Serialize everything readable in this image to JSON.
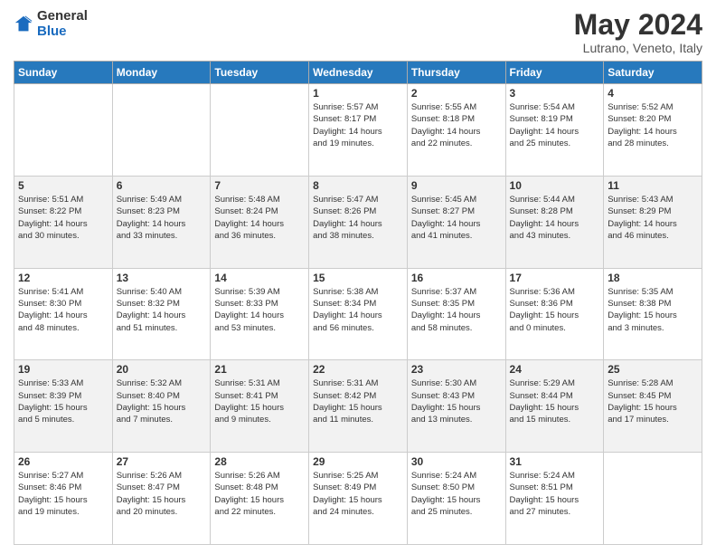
{
  "header": {
    "logo": {
      "general": "General",
      "blue": "Blue"
    },
    "title": "May 2024",
    "subtitle": "Lutrano, Veneto, Italy"
  },
  "calendar": {
    "weekdays": [
      "Sunday",
      "Monday",
      "Tuesday",
      "Wednesday",
      "Thursday",
      "Friday",
      "Saturday"
    ],
    "weeks": [
      [
        {
          "day": "",
          "info": ""
        },
        {
          "day": "",
          "info": ""
        },
        {
          "day": "",
          "info": ""
        },
        {
          "day": "1",
          "info": "Sunrise: 5:57 AM\nSunset: 8:17 PM\nDaylight: 14 hours\nand 19 minutes."
        },
        {
          "day": "2",
          "info": "Sunrise: 5:55 AM\nSunset: 8:18 PM\nDaylight: 14 hours\nand 22 minutes."
        },
        {
          "day": "3",
          "info": "Sunrise: 5:54 AM\nSunset: 8:19 PM\nDaylight: 14 hours\nand 25 minutes."
        },
        {
          "day": "4",
          "info": "Sunrise: 5:52 AM\nSunset: 8:20 PM\nDaylight: 14 hours\nand 28 minutes."
        }
      ],
      [
        {
          "day": "5",
          "info": "Sunrise: 5:51 AM\nSunset: 8:22 PM\nDaylight: 14 hours\nand 30 minutes."
        },
        {
          "day": "6",
          "info": "Sunrise: 5:49 AM\nSunset: 8:23 PM\nDaylight: 14 hours\nand 33 minutes."
        },
        {
          "day": "7",
          "info": "Sunrise: 5:48 AM\nSunset: 8:24 PM\nDaylight: 14 hours\nand 36 minutes."
        },
        {
          "day": "8",
          "info": "Sunrise: 5:47 AM\nSunset: 8:26 PM\nDaylight: 14 hours\nand 38 minutes."
        },
        {
          "day": "9",
          "info": "Sunrise: 5:45 AM\nSunset: 8:27 PM\nDaylight: 14 hours\nand 41 minutes."
        },
        {
          "day": "10",
          "info": "Sunrise: 5:44 AM\nSunset: 8:28 PM\nDaylight: 14 hours\nand 43 minutes."
        },
        {
          "day": "11",
          "info": "Sunrise: 5:43 AM\nSunset: 8:29 PM\nDaylight: 14 hours\nand 46 minutes."
        }
      ],
      [
        {
          "day": "12",
          "info": "Sunrise: 5:41 AM\nSunset: 8:30 PM\nDaylight: 14 hours\nand 48 minutes."
        },
        {
          "day": "13",
          "info": "Sunrise: 5:40 AM\nSunset: 8:32 PM\nDaylight: 14 hours\nand 51 minutes."
        },
        {
          "day": "14",
          "info": "Sunrise: 5:39 AM\nSunset: 8:33 PM\nDaylight: 14 hours\nand 53 minutes."
        },
        {
          "day": "15",
          "info": "Sunrise: 5:38 AM\nSunset: 8:34 PM\nDaylight: 14 hours\nand 56 minutes."
        },
        {
          "day": "16",
          "info": "Sunrise: 5:37 AM\nSunset: 8:35 PM\nDaylight: 14 hours\nand 58 minutes."
        },
        {
          "day": "17",
          "info": "Sunrise: 5:36 AM\nSunset: 8:36 PM\nDaylight: 15 hours\nand 0 minutes."
        },
        {
          "day": "18",
          "info": "Sunrise: 5:35 AM\nSunset: 8:38 PM\nDaylight: 15 hours\nand 3 minutes."
        }
      ],
      [
        {
          "day": "19",
          "info": "Sunrise: 5:33 AM\nSunset: 8:39 PM\nDaylight: 15 hours\nand 5 minutes."
        },
        {
          "day": "20",
          "info": "Sunrise: 5:32 AM\nSunset: 8:40 PM\nDaylight: 15 hours\nand 7 minutes."
        },
        {
          "day": "21",
          "info": "Sunrise: 5:31 AM\nSunset: 8:41 PM\nDaylight: 15 hours\nand 9 minutes."
        },
        {
          "day": "22",
          "info": "Sunrise: 5:31 AM\nSunset: 8:42 PM\nDaylight: 15 hours\nand 11 minutes."
        },
        {
          "day": "23",
          "info": "Sunrise: 5:30 AM\nSunset: 8:43 PM\nDaylight: 15 hours\nand 13 minutes."
        },
        {
          "day": "24",
          "info": "Sunrise: 5:29 AM\nSunset: 8:44 PM\nDaylight: 15 hours\nand 15 minutes."
        },
        {
          "day": "25",
          "info": "Sunrise: 5:28 AM\nSunset: 8:45 PM\nDaylight: 15 hours\nand 17 minutes."
        }
      ],
      [
        {
          "day": "26",
          "info": "Sunrise: 5:27 AM\nSunset: 8:46 PM\nDaylight: 15 hours\nand 19 minutes."
        },
        {
          "day": "27",
          "info": "Sunrise: 5:26 AM\nSunset: 8:47 PM\nDaylight: 15 hours\nand 20 minutes."
        },
        {
          "day": "28",
          "info": "Sunrise: 5:26 AM\nSunset: 8:48 PM\nDaylight: 15 hours\nand 22 minutes."
        },
        {
          "day": "29",
          "info": "Sunrise: 5:25 AM\nSunset: 8:49 PM\nDaylight: 15 hours\nand 24 minutes."
        },
        {
          "day": "30",
          "info": "Sunrise: 5:24 AM\nSunset: 8:50 PM\nDaylight: 15 hours\nand 25 minutes."
        },
        {
          "day": "31",
          "info": "Sunrise: 5:24 AM\nSunset: 8:51 PM\nDaylight: 15 hours\nand 27 minutes."
        },
        {
          "day": "",
          "info": ""
        }
      ]
    ]
  }
}
